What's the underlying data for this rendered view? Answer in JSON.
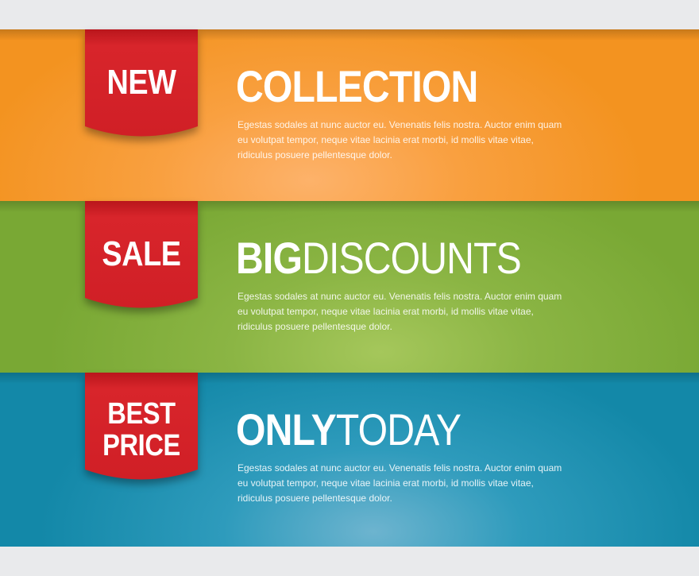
{
  "banners": [
    {
      "ribbon": [
        "NEW"
      ],
      "title_bold": "COLLECTION",
      "title_light": "",
      "description": "Egestas sodales at nunc auctor eu. Venenatis felis nostra. Auctor enim quam eu volutpat tempor, neque vitae lacinia erat morbi, id mollis vitae vitae, ridiculus posuere pellentesque dolor.",
      "color": "#f39320"
    },
    {
      "ribbon": [
        "SALE"
      ],
      "title_bold": "BIG",
      "title_light": "DISCOUNTS",
      "description": "Egestas sodales at nunc auctor eu. Venenatis felis nostra. Auctor enim quam eu volutpat tempor, neque vitae lacinia erat morbi, id mollis vitae vitae, ridiculus posuere pellentesque dolor.",
      "color": "#79a834"
    },
    {
      "ribbon": [
        "BEST",
        "PRICE"
      ],
      "title_bold": "ONLY",
      "title_light": "TODAY",
      "description": "Egestas sodales at nunc auctor eu. Venenatis felis nostra. Auctor enim quam eu volutpat tempor, neque vitae lacinia erat morbi, id mollis vitae vitae, ridiculus posuere pellentesque dolor.",
      "color": "#1388a8"
    }
  ],
  "ribbon_color": "#d42229"
}
